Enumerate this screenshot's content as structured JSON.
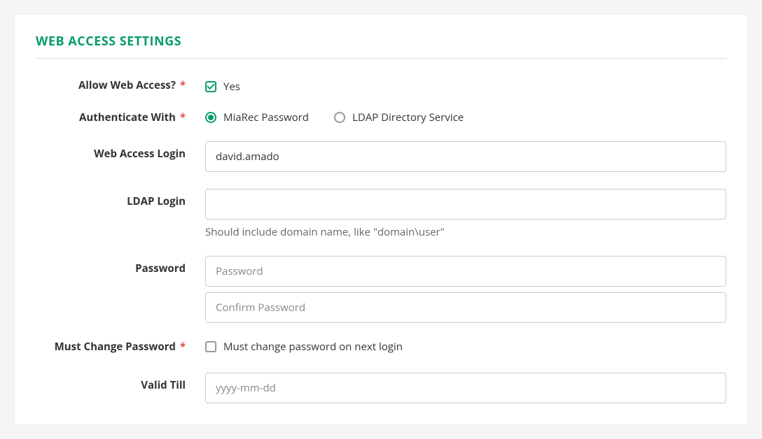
{
  "section": {
    "title": "WEB ACCESS SETTINGS"
  },
  "labels": {
    "allow_web_access": "Allow Web Access?",
    "authenticate_with": "Authenticate With",
    "web_access_login": "Web Access Login",
    "ldap_login": "LDAP Login",
    "password": "Password",
    "must_change_password": "Must Change Password",
    "valid_till": "Valid Till"
  },
  "fields": {
    "allow_web_access": {
      "checked": true,
      "text": "Yes"
    },
    "authenticate_with": {
      "options": {
        "miarec": "MiaRec Password",
        "ldap": "LDAP Directory Service"
      },
      "selected": "miarec"
    },
    "web_access_login": {
      "value": "david.amado"
    },
    "ldap_login": {
      "value": "",
      "help": "Should include domain name, like \"domain\\user\""
    },
    "password": {
      "placeholder": "Password",
      "confirm_placeholder": "Confirm Password"
    },
    "must_change_password": {
      "checked": false,
      "text": "Must change password on next login"
    },
    "valid_till": {
      "placeholder": "yyyy-mm-dd",
      "value": ""
    }
  }
}
